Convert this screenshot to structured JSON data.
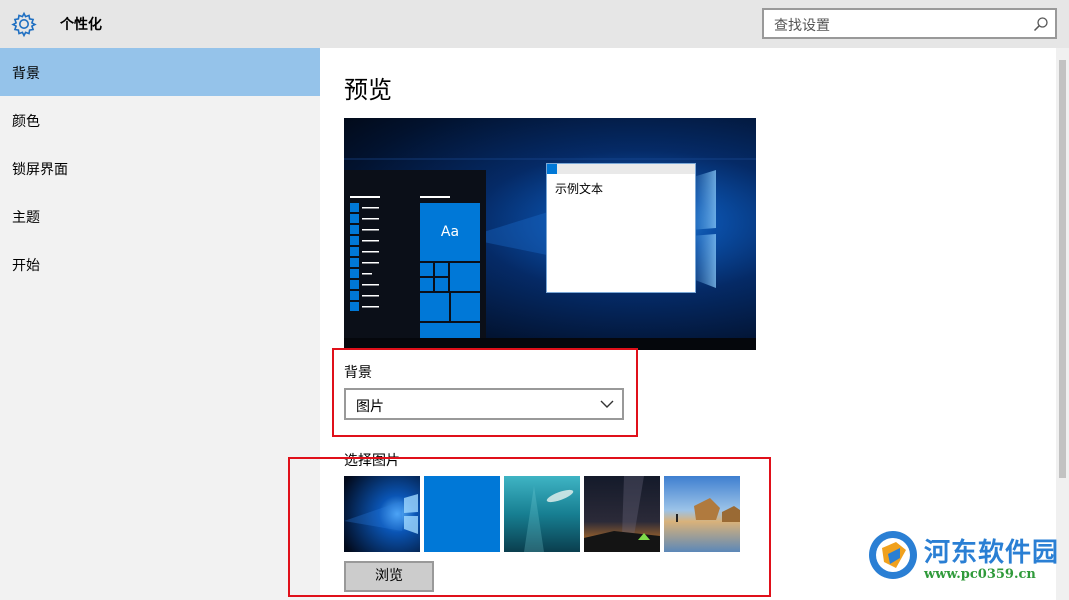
{
  "window": {
    "title": "个性化",
    "icon": "gear-icon"
  },
  "search": {
    "placeholder": "查找设置",
    "icon": "search-icon"
  },
  "sidebar": {
    "items": [
      {
        "label": "背景",
        "active": true
      },
      {
        "label": "颜色",
        "active": false
      },
      {
        "label": "锁屏界面",
        "active": false
      },
      {
        "label": "主题",
        "active": false
      },
      {
        "label": "开始",
        "active": false
      }
    ]
  },
  "main": {
    "preview_heading": "预览",
    "preview_sample_text": "示例文本",
    "preview_tile_text": "Aa",
    "background_label": "背景",
    "background_value": "图片",
    "choose_picture_label": "选择图片",
    "thumbnails": [
      {
        "name": "windows-hero-thumbnail"
      },
      {
        "name": "solid-blue-thumbnail"
      },
      {
        "name": "underwater-swimmer-thumbnail"
      },
      {
        "name": "night-sky-tent-thumbnail"
      },
      {
        "name": "beach-rocks-thumbnail"
      }
    ],
    "browse_label": "浏览"
  },
  "colors": {
    "accent": "#0078d7",
    "sidebar_active": "#95c3ea",
    "highlight_box": "#e0101a"
  },
  "watermark": {
    "text": "河东软件园",
    "url": "www.pc0359.cn"
  }
}
